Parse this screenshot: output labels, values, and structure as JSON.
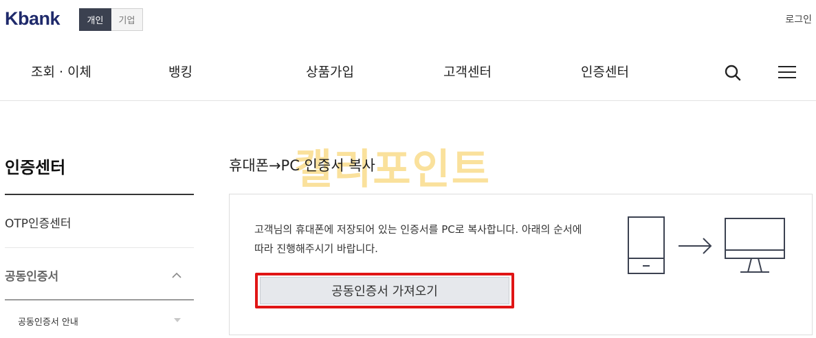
{
  "header": {
    "logo": "Kbank",
    "segments": [
      {
        "label": "개인",
        "active": true
      },
      {
        "label": "기업",
        "active": false
      }
    ],
    "login": "로그인"
  },
  "nav": {
    "items": [
      "조회 · 이체",
      "뱅킹",
      "상품가입",
      "고객센터",
      "인증센터"
    ],
    "icons": [
      "search-icon",
      "menu-icon"
    ]
  },
  "sidebar": {
    "title": "인증센터",
    "items": [
      {
        "label": "OTP인증센터"
      },
      {
        "label": "공동인증서",
        "expanded": true
      },
      {
        "label": "공동인증서 안내"
      }
    ]
  },
  "watermark": "캘리포인트",
  "main": {
    "title": "휴대폰→PC 인증서 복사",
    "description": "고객님의 휴대폰에 저장되어 있는 인증서를 PC로 복사합니다. 아래의 순서에 따라 진행해주시기 바랍니다.",
    "button_label": "공동인증서 가져오기",
    "illustration": [
      "phone-icon",
      "arrow-right-icon",
      "monitor-icon"
    ]
  },
  "colors": {
    "brand": "#1f2a6b",
    "highlight": "#e01515",
    "segment_active": "#3b4150",
    "watermark": "#f6c94c"
  }
}
